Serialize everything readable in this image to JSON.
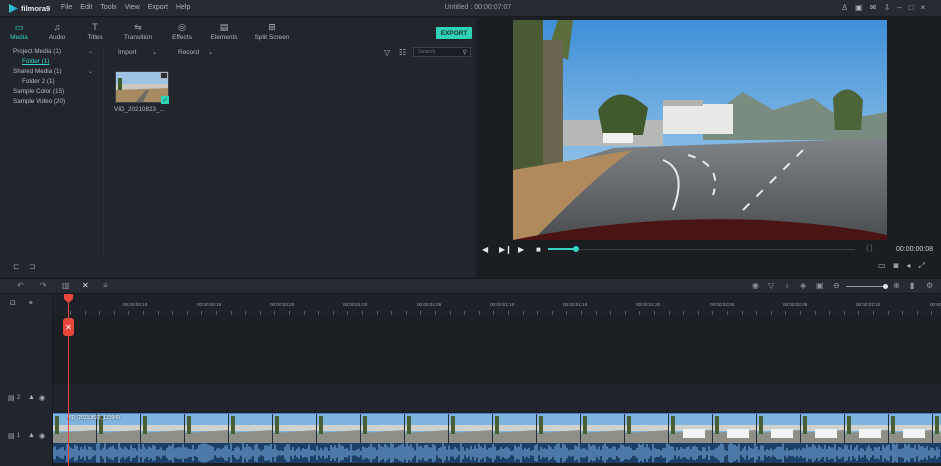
{
  "app": {
    "name": "filmora9",
    "doc_title": "Untitled : 00:00:07:07"
  },
  "menu": [
    "File",
    "Edit",
    "Tools",
    "View",
    "Export",
    "Help"
  ],
  "tabs": [
    {
      "label": "Media",
      "icon": "folder-icon",
      "active": true
    },
    {
      "label": "Audio",
      "icon": "music-note-icon"
    },
    {
      "label": "Titles",
      "icon": "text-icon"
    },
    {
      "label": "Transition",
      "icon": "transition-icon"
    },
    {
      "label": "Effects",
      "icon": "effects-icon"
    },
    {
      "label": "Elements",
      "icon": "elements-icon"
    },
    {
      "label": "Split Screen",
      "icon": "split-screen-icon"
    }
  ],
  "export_label": "EXPORT",
  "media_toolbar": {
    "import": "Import",
    "record": "Record",
    "search_placeholder": "Search"
  },
  "tree": [
    {
      "label": "Project Media (1)"
    },
    {
      "label": "Folder (1)",
      "active": true
    },
    {
      "label": "Shared Media (1)"
    },
    {
      "label": "Folder 2 (1)"
    },
    {
      "label": "Sample Color (15)"
    },
    {
      "label": "Sample Video (20)"
    }
  ],
  "media_item": {
    "label": "VID_20210823_..."
  },
  "preview": {
    "timecode": "00:00:00:08",
    "progress": 0.09
  },
  "ruler_labels": [
    "00:00:00:00",
    "00:00:00:10",
    "00:00:00:15",
    "00:00:00:20",
    "00:00:01:00",
    "00:00:01:05",
    "00:00:01:10",
    "00:00:01:15",
    "00:00:01:20",
    "00:00:02:00",
    "00:00:02:05",
    "00:00:02:10",
    "00:00:02:15"
  ],
  "tracks": [
    {
      "label": "2"
    },
    {
      "label": "1"
    }
  ],
  "clip_label": "VID_20210823_133949",
  "colors": {
    "accent": "#32d3c3",
    "playhead": "#e8473d",
    "export": "#2fd1b7",
    "audio": "#1b3f66"
  }
}
